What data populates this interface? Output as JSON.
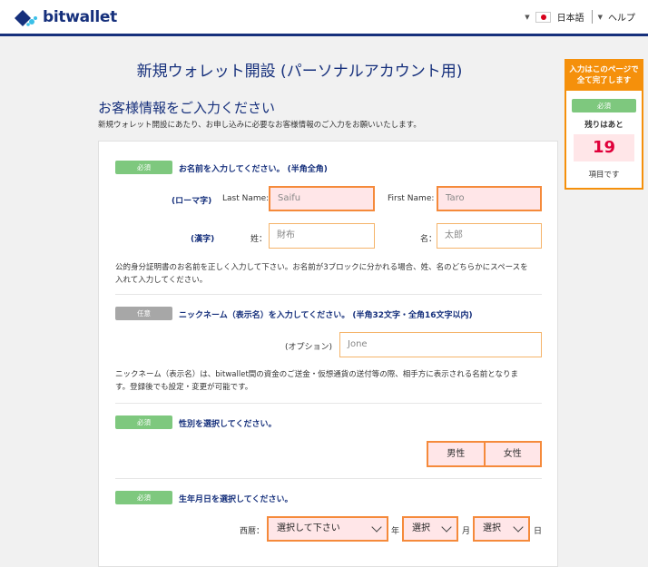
{
  "header": {
    "brand": "bitwallet",
    "language": "日本語",
    "help": "ヘルプ"
  },
  "page": {
    "title": "新規ウォレット開設 (パーソナルアカウント用)",
    "section_title": "お客様情報をご入力ください",
    "section_desc": "新規ウォレット開設にあたり、お申し込みに必要なお客様情報のご入力をお願いいたします。"
  },
  "form": {
    "name": {
      "badge": "必須",
      "title": "お名前を入力してください。 (半角全角)",
      "romaji_label": "(ローマ字)",
      "last_name_label": "Last Name:",
      "last_name_placeholder": "Saifu",
      "first_name_label": "First Name:",
      "first_name_placeholder": "Taro",
      "kanji_label": "(漢字)",
      "sei_label": "姓：",
      "sei_placeholder": "財布",
      "mei_label": "名：",
      "mei_placeholder": "太郎",
      "note_line1": "公的身分証明書のお名前を正しく入力して下さい。お名前が3ブロックに分かれる場合、姓、名のどちらかにスペースを",
      "note_line2": "入れて入力してください。"
    },
    "nickname": {
      "badge": "任意",
      "title": "ニックネーム（表示名）を入力してください。 (半角32文字・全角16文字以内)",
      "option_label": "(オプション)",
      "placeholder": "Jone",
      "note_line1": "ニックネーム（表示名）は、bitwallet間の資金のご送金・仮想通貨の送付等の際、相手方に表示される名前となりま",
      "note_line2": "す。登録後でも設定・変更が可能です。"
    },
    "gender": {
      "badge": "必須",
      "title": "性別を選択してください。",
      "male": "男性",
      "female": "女性"
    },
    "birthday": {
      "badge": "必須",
      "title": "生年月日を選択してください。",
      "era_label": "西暦：",
      "year_select": "選択して下さい",
      "year_unit": "年",
      "month_select": "選択",
      "month_unit": "月",
      "day_select": "選択",
      "day_unit": "日"
    }
  },
  "progress": {
    "head_line1": "入力はこのページで",
    "head_line2": "全て完了します",
    "badge": "必須",
    "remaining_label": "残りはあと",
    "remaining_count": "19",
    "suffix": "項目です"
  }
}
